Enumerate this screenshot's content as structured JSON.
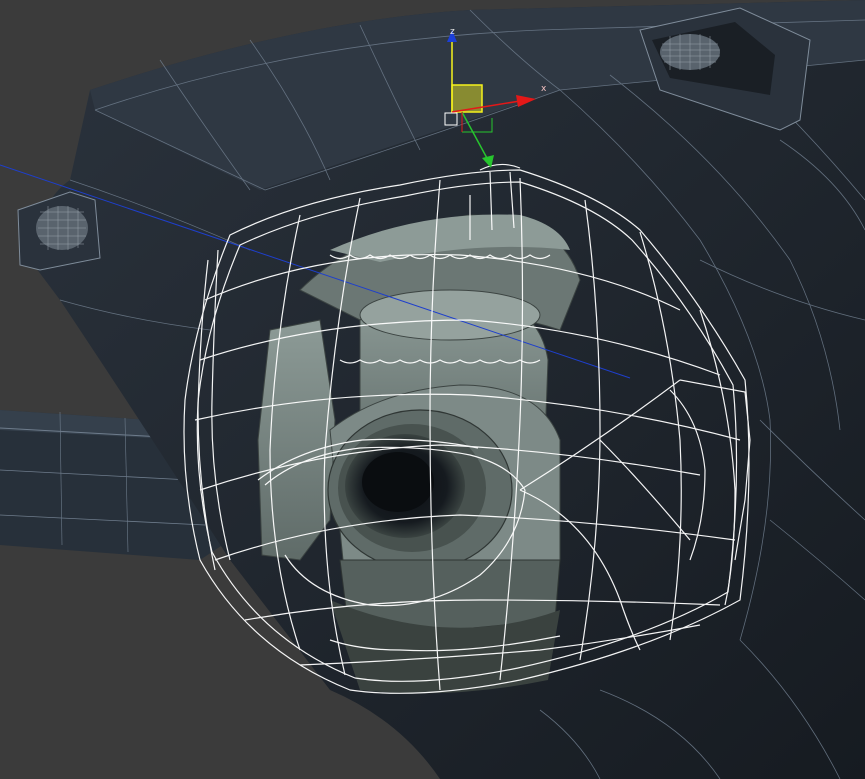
{
  "viewport": {
    "gizmo": {
      "z_label": "z",
      "x_label": "x"
    },
    "colors": {
      "background": "#3a3a3a",
      "body": "#1c222a",
      "wire_body": "#6e7c8c",
      "gimbal": "#7f8d89",
      "cage_wire": "#ffffff",
      "axis_x": "#e41818",
      "axis_y": "#27c52e",
      "axis_z": "#f6f21c",
      "grid_line": "#1e3fcc"
    },
    "icons": [
      "move-gizmo-icon"
    ]
  }
}
